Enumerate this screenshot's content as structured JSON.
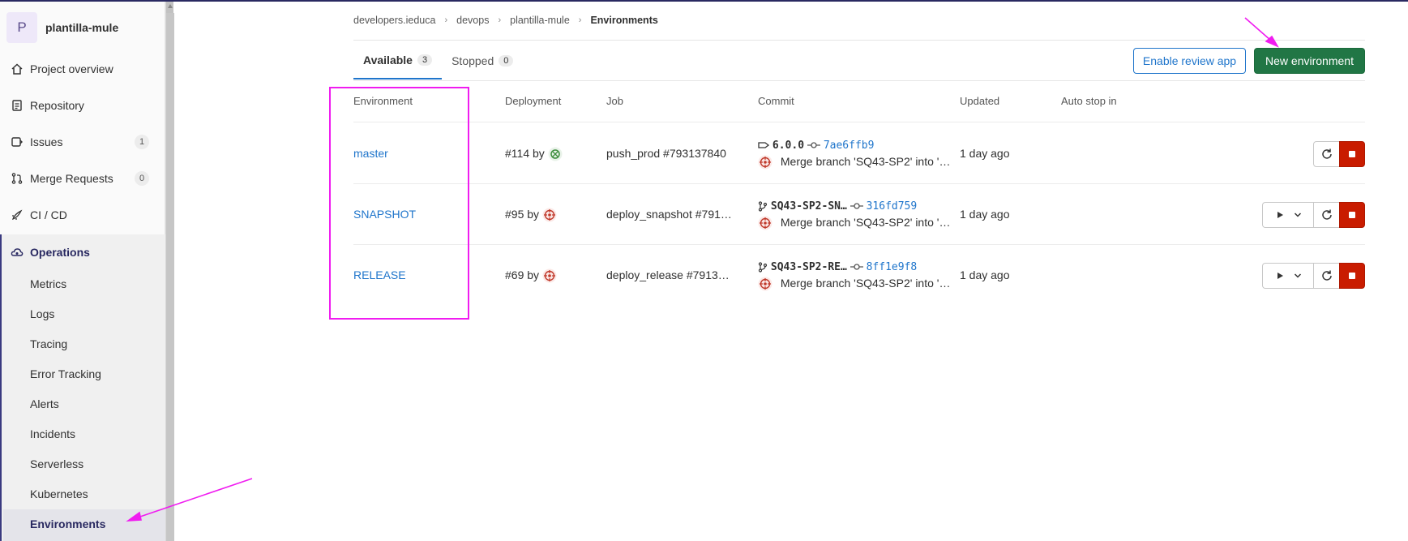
{
  "project": {
    "initial": "P",
    "name": "plantilla-mule"
  },
  "sidebar": {
    "items": [
      {
        "label": "Project overview",
        "icon": "home-icon"
      },
      {
        "label": "Repository",
        "icon": "document-icon"
      },
      {
        "label": "Issues",
        "icon": "issues-icon",
        "count": "1"
      },
      {
        "label": "Merge Requests",
        "icon": "merge-request-icon",
        "count": "0"
      },
      {
        "label": "CI / CD",
        "icon": "rocket-icon"
      },
      {
        "label": "Operations",
        "icon": "cloud-gear-icon"
      }
    ],
    "operations_sub": [
      "Metrics",
      "Logs",
      "Tracing",
      "Error Tracking",
      "Alerts",
      "Incidents",
      "Serverless",
      "Kubernetes",
      "Environments"
    ]
  },
  "breadcrumb": [
    "developers.ieduca",
    "devops",
    "plantilla-mule",
    "Environments"
  ],
  "tabs": [
    {
      "label": "Available",
      "count": "3"
    },
    {
      "label": "Stopped",
      "count": "0"
    }
  ],
  "buttons": {
    "review": "Enable review app",
    "new_env": "New environment"
  },
  "table": {
    "headers": [
      "Environment",
      "Deployment",
      "Job",
      "Commit",
      "Updated",
      "Auto stop in"
    ],
    "rows": [
      {
        "env": "master",
        "deployment": "#114 by",
        "job": "push_prod #793137840",
        "ref": "6.0.0",
        "ref_type": "tag",
        "hash": "7ae6ffb9",
        "message": "Merge branch 'SQ43-SP2' into '…",
        "updated": "1 day ago"
      },
      {
        "env": "SNAPSHOT",
        "deployment": "#95 by",
        "job": "deploy_snapshot #791…",
        "ref": "SQ43-SP2-SN…",
        "ref_type": "branch",
        "hash": "316fd759",
        "message": "Merge branch 'SQ43-SP2' into '…",
        "updated": "1 day ago"
      },
      {
        "env": "RELEASE",
        "deployment": "#69 by",
        "job": "deploy_release #7913…",
        "ref": "SQ43-SP2-RE…",
        "ref_type": "branch",
        "hash": "8ff1e9f8",
        "message": "Merge branch 'SQ43-SP2' into '…",
        "updated": "1 day ago"
      }
    ]
  },
  "colors": {
    "annotation": "#f01cf0",
    "primary": "#1f75cb",
    "success": "#217645",
    "danger": "#c91c00"
  }
}
